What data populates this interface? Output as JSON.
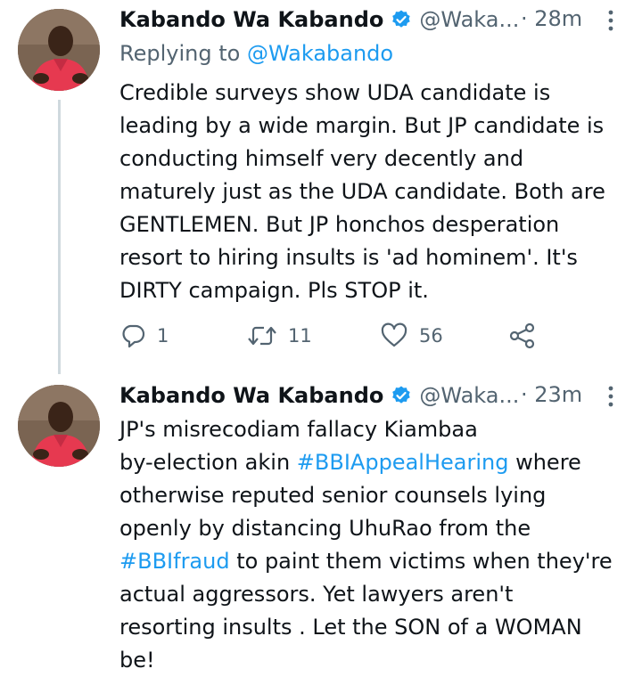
{
  "tweets": [
    {
      "author_name": "Kabando Wa Kabando",
      "handle": "@Waka...",
      "time": "· 28m",
      "replying_prefix": "Replying to ",
      "replying_handle": "@Wakabando",
      "text": "Credible surveys show UDA candidate is\nleading by a wide margin. But JP candidate is\nconducting himself very decently and\nmaturely just as the UDA candidate. Both are\nGENTLEMEN. But JP honchos desperation\nresort to hiring insults is 'ad hominem'. It's\nDIRTY campaign. Pls STOP it.",
      "replies": "1",
      "retweets": "11",
      "likes": "56"
    },
    {
      "author_name": "Kabando Wa Kabando",
      "handle": "@Waka...",
      "time": "· 23m",
      "text_1": "JP's misrecodiam fallacy Kiambaa\nby-election akin ",
      "hashtag_1": "#BBIAppealHearing",
      "text_2": " where\notherwise reputed senior counsels lying\nopenly by distancing UhuRao from the\n",
      "hashtag_2": "#BBIfraud",
      "text_3": " to paint them victims when they're\nactual aggressors. Yet lawyers aren't\nresorting insults . Let the SON of a WOMAN\nbe!"
    }
  ],
  "colors": {
    "accent": "#1d9bf0",
    "secondary_text": "#536471",
    "thread_line": "#cfd9de"
  }
}
